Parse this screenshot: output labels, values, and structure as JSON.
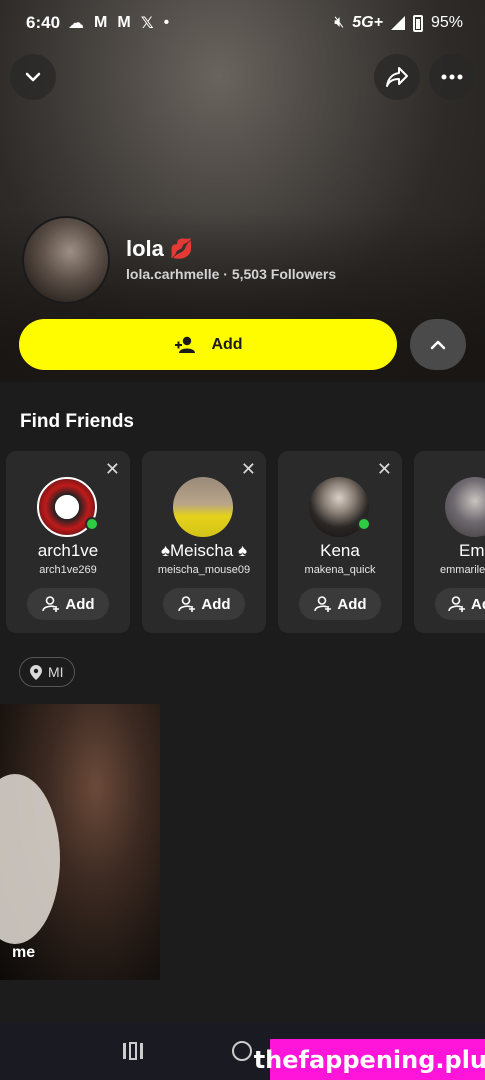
{
  "status": {
    "time": "6:40",
    "network": "5G+",
    "battery": "95%"
  },
  "profile": {
    "name": "lola",
    "emoji": "💋",
    "username": "lola.carhmelle",
    "followers": "5,503 Followers",
    "separator": "·",
    "add_label": "Add"
  },
  "find_friends": {
    "title": "Find Friends",
    "cards": [
      {
        "name": "arch1ve",
        "username": "arch1ve269",
        "add_label": "Add",
        "online": true
      },
      {
        "name": "♠Meischa ♠",
        "username": "meischa_mouse09",
        "add_label": "Add",
        "online": false
      },
      {
        "name": "Kena",
        "username": "makena_quick",
        "add_label": "Add",
        "online": true
      },
      {
        "name": "Em",
        "username": "emmarile",
        "add_label": "Ad",
        "online": false
      }
    ]
  },
  "location": {
    "label": "MI"
  },
  "story": {
    "label": "me"
  },
  "watermark": "thefappening.plus"
}
